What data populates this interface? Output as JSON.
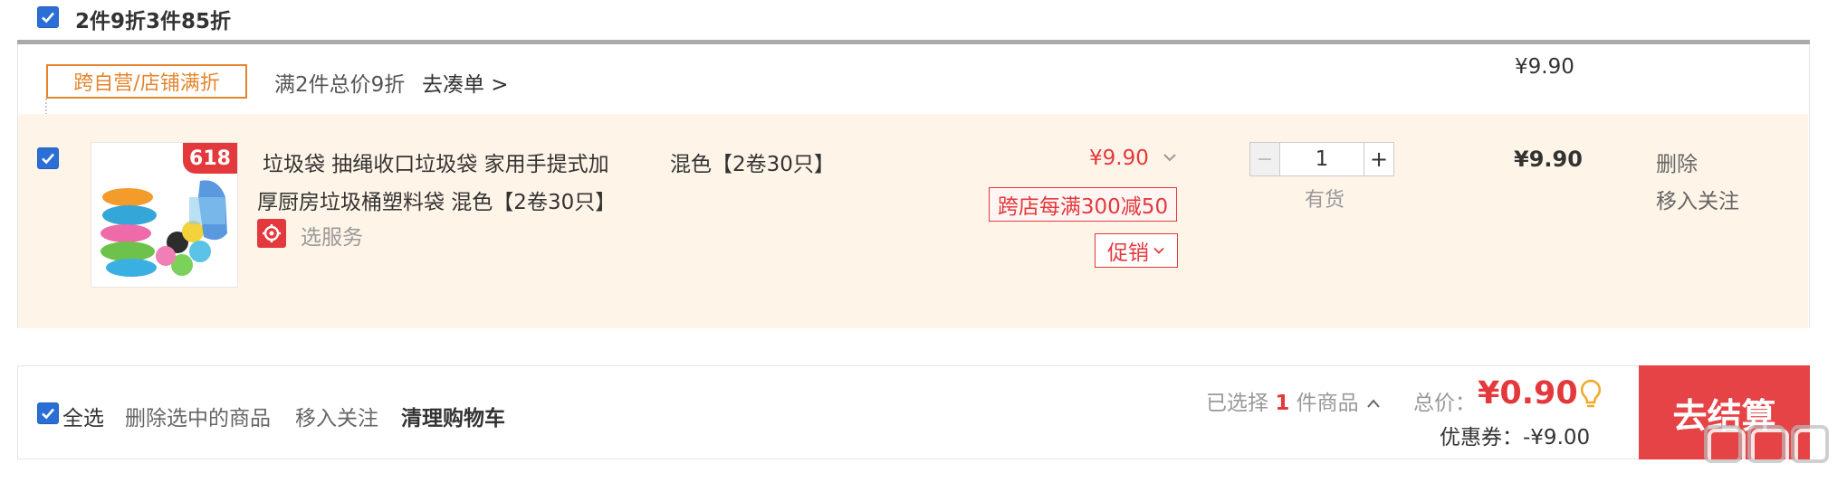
{
  "header": {
    "title": "2件9折3件85折"
  },
  "shop_promo": {
    "tag": "跨自营/店铺满折",
    "text": "满2件总价9折",
    "link": "去凑单 >",
    "total": "¥9.90"
  },
  "item": {
    "badge": "618",
    "title_line1": "垃圾袋 抽绳收口垃圾袋 家用手提式加",
    "title_line2": "厚厨房垃圾桶塑料袋 混色【2卷30只】",
    "service": "选服务",
    "spec": "混色【2卷30只】",
    "unit_price": "¥9.90",
    "promo_badge": "跨店每满300减50",
    "promo_button": "促销",
    "quantity": "1",
    "qty_minus": "−",
    "qty_plus": "+",
    "stock": "有货",
    "subtotal": "¥9.90",
    "delete": "删除",
    "move_to_fav": "移入关注"
  },
  "footer": {
    "select_all": "全选",
    "delete_selected": "删除选中的商品",
    "move_to_fav": "移入关注",
    "clear_cart": "清理购物车",
    "selected_prefix": "已选择",
    "selected_count": "1",
    "selected_suffix": "件商品",
    "total_label": "总价：",
    "total_value": "¥0.90",
    "coupon": "优惠券：-¥9.00",
    "checkout": "去结算"
  },
  "colors": {
    "accent": "#e4393c",
    "checkbox": "#2b6fd6",
    "promo_tag": "#e4852e",
    "item_bg": "#fff4e8"
  }
}
